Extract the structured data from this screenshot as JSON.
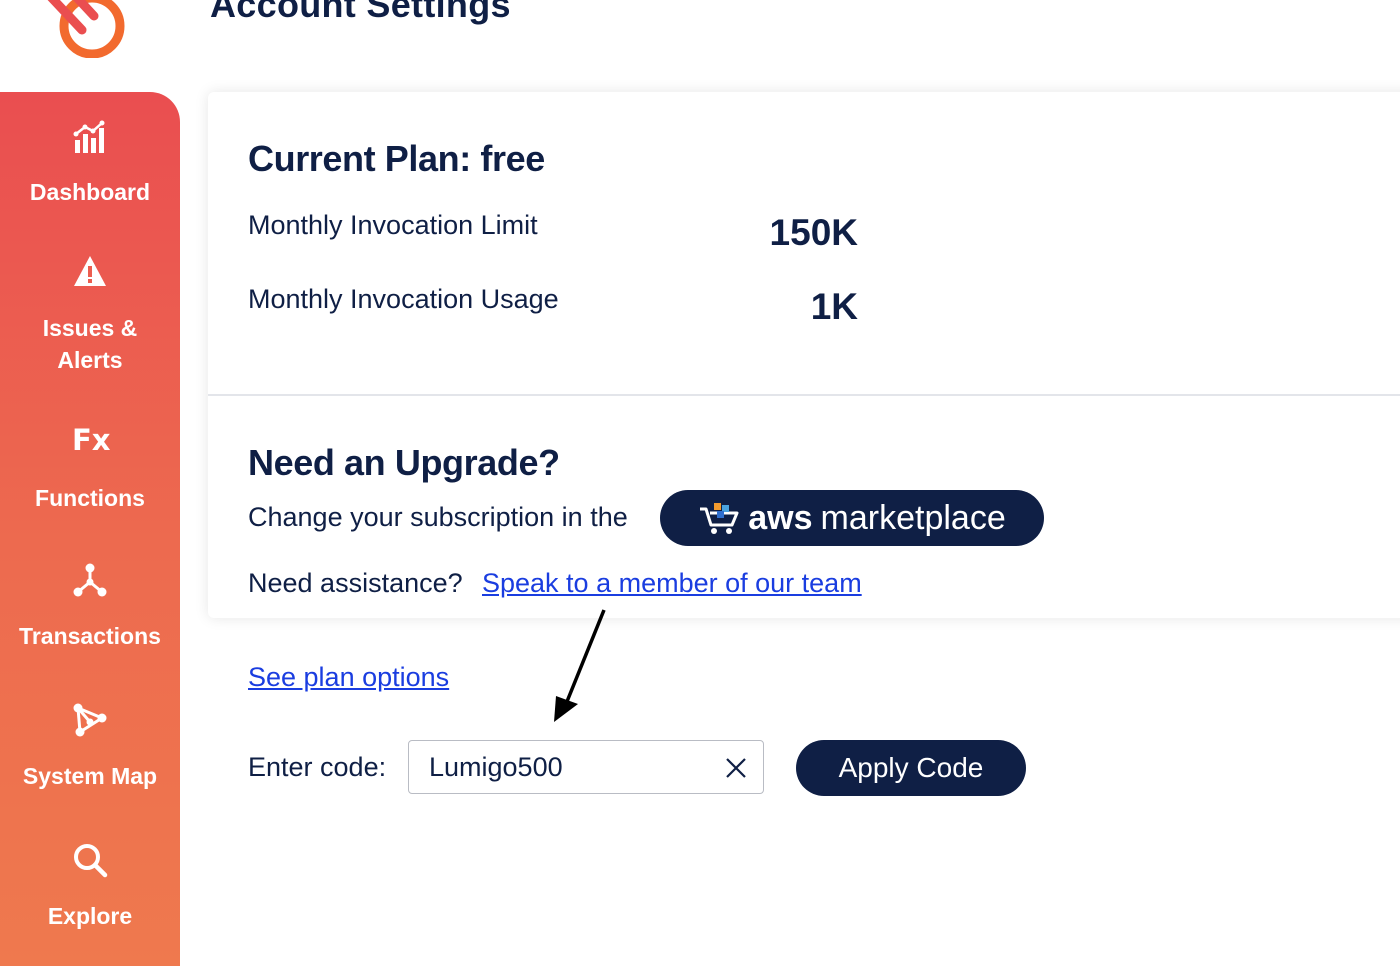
{
  "header": {
    "title": "Account Settings"
  },
  "colors": {
    "sidebar_gradient_start": "#ea4e50",
    "sidebar_gradient_end": "#ef7a4e",
    "navy": "#0f1f45",
    "link": "#1a3de0",
    "logo_orange": "#f26a2e"
  },
  "sidebar": {
    "items": [
      {
        "label": "Dashboard",
        "icon": "bar-chart-icon"
      },
      {
        "label": "Issues & Alerts",
        "icon": "warning-icon"
      },
      {
        "label": "Functions",
        "icon": "fx-icon",
        "glyph": "Fx"
      },
      {
        "label": "Transactions",
        "icon": "transactions-icon"
      },
      {
        "label": "System Map",
        "icon": "system-map-icon"
      },
      {
        "label": "Explore",
        "icon": "search-icon"
      }
    ]
  },
  "plan": {
    "title": "Current Plan: free",
    "limit_label": "Monthly Invocation Limit",
    "limit_value": "150K",
    "usage_label": "Monthly Invocation Usage",
    "usage_value": "1K"
  },
  "upgrade": {
    "title": "Need an Upgrade?",
    "subscription_text": "Change your subscription in the",
    "aws_bold": "aws",
    "aws_light": "marketplace",
    "assistance_text": "Need assistance?",
    "assistance_link": "Speak to a member of our team"
  },
  "plan_options_link": "See plan options",
  "code": {
    "label": "Enter code:",
    "value": "Lumigo500",
    "apply_label": "Apply Code"
  }
}
